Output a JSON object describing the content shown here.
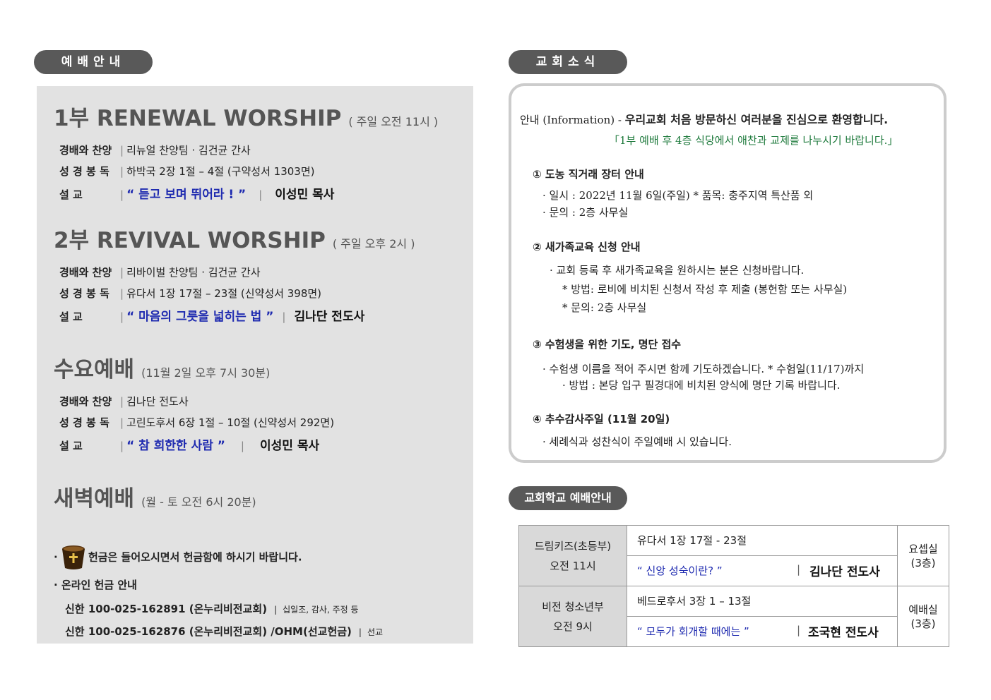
{
  "worship_header": "예배안내",
  "news_header": "교회소식",
  "school_header": "교회학교 예배안내",
  "services": [
    {
      "title": "1부  RENEWAL  WORSHIP",
      "time": "( 주일 오전 11시 )",
      "rows": [
        {
          "label": "경배와 찬양",
          "sep": "|",
          "text": "리뉴얼 찬양팀 ·  김건균 간사"
        },
        {
          "label": "성 경 봉 독",
          "sep": "|",
          "text": "하박국 2장 1절 – 4절 (구약성서 1303면)"
        },
        {
          "label": "설        교",
          "sep": "|",
          "quote": "“ 듣고 보며 뛰어라 ! ”",
          "bar": "|",
          "speaker": "이성민 목사"
        }
      ]
    },
    {
      "title": "2부  REVIVAL  WORSHIP",
      "time": "( 주일 오후 2시 )",
      "rows": [
        {
          "label": "경배와 찬양",
          "sep": "|",
          "text": "리바이벌 찬양팀 ·  김건균 간사"
        },
        {
          "label": "성 경 봉 독",
          "sep": "|",
          "text": "유다서 1장 17절 – 23절  (신약성서 398면)"
        },
        {
          "label": "설        교",
          "sep": "|",
          "quote": "“ 마음의 그릇을 넓히는 법 ”",
          "bar": "|",
          "speaker": "김나단 전도사"
        }
      ]
    },
    {
      "title": "수요예배",
      "time": "(11월 2일 오후 7시 30분)",
      "rows": [
        {
          "label": "경배와 찬양",
          "sep": "|",
          "text": "김나단 전도사"
        },
        {
          "label": "성 경 봉 독",
          "sep": "|",
          "text": "고린도후서 6장 1절 – 10절  (신약성서 292면)"
        },
        {
          "label": "설        교",
          "sep": "|",
          "quote": "“ 참 희한한 사람 ”",
          "bar": "|",
          "speaker": "이성민 목사"
        }
      ]
    },
    {
      "title": "새벽예배",
      "time": "(월 - 토 오전 6시 20분)",
      "rows": []
    }
  ],
  "offering": {
    "line1": "헌금은 들어오시면서 헌금함에 하시기 바랍니다.",
    "line2": "온라인 헌금 안내",
    "account1": "신한 100-025-162891 (온누리비전교회)",
    "account1_note": "십일조, 감사, 주정 등",
    "account2": "신한 100-025-162876 (온누리비전교회) /OHM(선교헌금)",
    "account2_note": "선교",
    "bullet": "·",
    "bar": "|"
  },
  "news": {
    "intro_label": "안내 (Information) -",
    "intro_text": "우리교회 처음 방문하신 여러분을 진심으로 환영합니다.",
    "intro_sub": "「1부 예배 후 4층 식당에서 애찬과 교제를 나누시기 바랍니다.」",
    "items": [
      {
        "title": "① 도농 직거래 장터 안내",
        "lines": [
          "· 일시 : 2022년 11월 6일(주일) * 품목: 충주지역 특산품 외",
          "· 문의 : 2층 사무실"
        ]
      },
      {
        "title": "② 새가족교육 신청 안내",
        "lines": [
          "· 교회 등록 후 새가족교육을 원하시는 분은 신청바랍니다.",
          "* 방법: 로비에 비치된 신청서 작성 후 제출 (봉헌함 또는 사무실)",
          "* 문의: 2층 사무실"
        ]
      },
      {
        "title": "③ 수험생을 위한 기도, 명단 접수",
        "lines": [
          "· 수험생 이름을 적어 주시면 함께 기도하겠습니다. * 수험일(11/17)까지",
          "· 방법 : 본당 입구 필경대에 비치된 양식에 명단 기록 바랍니다."
        ]
      },
      {
        "title": "④ 추수감사주일 (11월 20일)",
        "lines": [
          "· 세례식과 성찬식이 주일예배 시 있습니다."
        ]
      }
    ]
  },
  "school": [
    {
      "group": "드림키즈(초등부)",
      "time": "오전 11시",
      "scripture": "유다서 1장 17절 - 23절",
      "sermon": "“ 신앙 성숙이란? ”",
      "bar": "|",
      "speaker": "김나단 전도사",
      "room": "요셉실",
      "floor": "(3층)"
    },
    {
      "group": "비전 청소년부",
      "time": "오전 9시",
      "scripture": "베드로후서 3장 1 – 13절",
      "sermon": "“ 모두가 회개할 때에는 ”",
      "bar": "|",
      "speaker": "조국현 전도사",
      "room": "예배실",
      "floor": "(3층)"
    }
  ]
}
